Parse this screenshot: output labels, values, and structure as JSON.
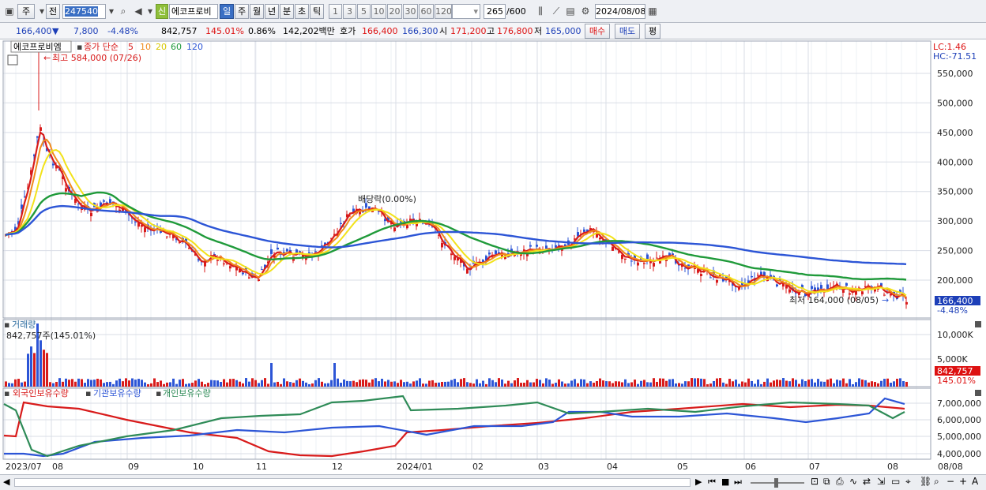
{
  "toolbar": {
    "mode_label": "주",
    "prev_label": "전",
    "code_value": "247540",
    "new_badge": "신",
    "stock_name": "에코프로비",
    "period_buttons": [
      "일",
      "주",
      "월",
      "년",
      "분",
      "초",
      "틱"
    ],
    "active_period": "일",
    "interval_buttons": [
      "1",
      "3",
      "5",
      "10",
      "20",
      "30",
      "60",
      "120"
    ],
    "count_value": "265",
    "count_total": "/600",
    "date_value": "2024/08/08"
  },
  "quote": {
    "price": "166,400",
    "change": "7,800",
    "change_arrow": "▼",
    "change_pct": "-4.48%",
    "volume": "842,757",
    "volume_ratio": "145.01%",
    "turnover_pct": "0.86%",
    "amount": "142,202백만",
    "hoga_label": "호가",
    "ask": "166,400",
    "bid": "166,300",
    "open_label": "시",
    "open": "171,200",
    "high_label": "고",
    "high": "176,800",
    "low_label": "저",
    "low": "165,000",
    "buy_label": "매수",
    "sell_label": "매도",
    "avg_label": "평"
  },
  "price_panel": {
    "name_tag": "에코프로비엠",
    "legend_prefix": "종가 단순",
    "ma_periods": [
      "5",
      "10",
      "20",
      "60",
      "120"
    ],
    "ma_colors": [
      "#d81b1b",
      "#f08a1c",
      "#f2e21a",
      "#1f9a3a",
      "#2c55d6"
    ],
    "lc_label": "LC:1.46",
    "hc_label": "HC:-71.51",
    "high_annotation": "최고 584,000 (07/26)",
    "low_annotation": "최저 164,000 (08/05)",
    "dividend_annotation": "배당락(0.00%)",
    "current_price_tag": "166,400",
    "current_pct_tag": "-4.48%",
    "y_ticks": [
      "550,000",
      "500,000",
      "450,000",
      "400,000",
      "350,000",
      "300,000",
      "250,000",
      "200,000"
    ]
  },
  "volume_panel": {
    "title": "거래량",
    "current_label": "842,757주(145.01%)",
    "y_ticks": [
      "10,000K",
      "5,000K"
    ],
    "current_tag": "842,757",
    "current_pct": "145.01%"
  },
  "holdings_panel": {
    "series": [
      "외국인보유수량",
      "기관보유수량",
      "개인보유수량"
    ],
    "series_colors": [
      "#d81b1b",
      "#2c55d6",
      "#2e8b57"
    ],
    "y_ticks": [
      "7,000,000",
      "6,000,000",
      "5,000,000",
      "4,000,000"
    ]
  },
  "x_axis": {
    "labels": [
      "2023/07",
      "08",
      "09",
      "10",
      "11",
      "12",
      "2024/01",
      "02",
      "03",
      "04",
      "05",
      "06",
      "07",
      "08"
    ],
    "right_label": "08/08"
  },
  "colors": {
    "up": "#d81b1b",
    "down": "#2c55d6",
    "grid": "#d9dde6",
    "tag_blue": "#1d3fb8",
    "tag_red": "#d11"
  }
}
